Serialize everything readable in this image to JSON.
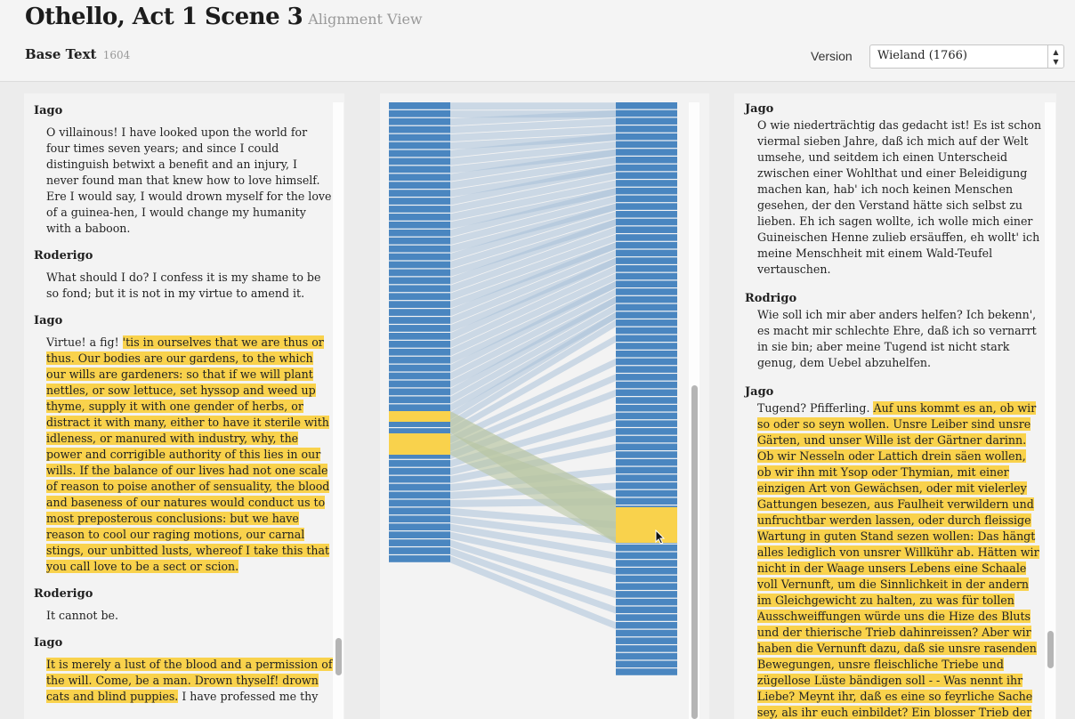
{
  "header": {
    "title": "Othello, Act 1 Scene 3",
    "subtitle": "Alignment View",
    "base_label": "Base Text",
    "base_year": "1604",
    "version_label": "Version",
    "version_selected": "Wieland (1766)"
  },
  "left": {
    "speeches": [
      {
        "speaker": "Iago",
        "plain": "O villainous! I have looked upon the world for four times seven years; and since I could distinguish betwixt a benefit and an injury, I never found man that knew how to love himself. Ere I would say, I would drown myself for the love of a guinea-hen, I would change my humanity with a baboon.",
        "highlight": "",
        "after": ""
      },
      {
        "speaker": "Roderigo",
        "plain": "What should I do? I confess it is my shame to be so fond; but it is not in my virtue to amend it.",
        "highlight": "",
        "after": ""
      },
      {
        "speaker": "Iago",
        "plain": "Virtue! a fig! ",
        "highlight": "'tis in ourselves that we are thus or thus. Our bodies are our gardens, to the which our wills are gardeners: so that if we will plant nettles, or sow lettuce, set hyssop and weed up thyme, supply it with one gender of herbs, or distract it with many, either to have it sterile with idleness, or manured with industry, why, the power and corrigible authority of this lies in our wills. If the balance of our lives had not one scale of reason to poise another of sensuality, the blood and baseness of our natures would conduct us to most preposterous conclusions: but we have reason to cool our raging motions, our carnal stings, our unbitted lusts, whereof I take this that you call love to be a sect or scion.",
        "after": ""
      },
      {
        "speaker": "Roderigo",
        "plain": "It cannot be.",
        "highlight": "",
        "after": ""
      },
      {
        "speaker": "Iago",
        "plain": "",
        "highlight": "It is merely a lust of the blood and a permission of the will. Come, be a man. Drown thyself! drown cats and blind puppies.",
        "after": " I have professed me thy"
      }
    ]
  },
  "right": {
    "speeches": [
      {
        "speaker": "Jago",
        "plain": "O wie niederträchtig das gedacht ist! Es ist schon viermal sieben Jahre, daß ich mich auf der Welt umsehe, und seitdem ich einen Unterscheid zwischen einer Wohlthat und einer Beleidigung machen kan, hab' ich noch keinen Menschen gesehen, der den Verstand hätte sich selbst zu lieben. Eh ich sagen wollte, ich wolle mich einer Guineischen Henne zulieb ersäuffen, eh wollt' ich meine Menschheit mit einem Wald-Teufel vertauschen.",
        "highlight": "",
        "after": ""
      },
      {
        "speaker": "Rodrigo",
        "plain": "Wie soll ich mir aber anders helfen? Ich bekenn', es macht mir schlechte Ehre, daß ich so vernarrt in sie bin; aber meine Tugend ist nicht stark genug, dem Uebel abzuhelfen.",
        "highlight": "",
        "after": ""
      },
      {
        "speaker": "Jago",
        "plain": "Tugend? Pfifferling. ",
        "highlight": "Auf uns kommt es an, ob wir so oder so seyn wollen. Unsre Leiber sind unsre Gärten, und unser Wille ist der Gärtner darinn. Ob wir Nesseln oder Lattich drein säen wollen, ob wir ihn mit Ysop oder Thymian, mit einer einzigen Art von Gewächsen, oder mit vielerley Gattungen besezen, aus Faulheit verwildern und unfruchtbar werden lassen, oder durch fleissige Wartung in guten Stand sezen wollen: Das hängt alles lediglich von unsrer Willkühr ab. Hätten wir nicht in der Waage unsers Lebens eine Schaale voll Vernunft, um die Sinnlichkeit in der andern im Gleichgewicht zu halten, zu was für tollen Ausschweiffungen würde uns die Hize des Bluts und der thierische Trieb dahinreissen? Aber wir haben die Vernunft dazu, daß sie unsre rasenden Bewegungen, unsre fleischliche Triebe und zügellose Lüste bändigen soll - - Was nennt ihr Liebe? Meynt ihr, daß es eine so feyrliche Sache sey, als ihr euch einbildet? Ein blosser Trieb der Blutes ist's, dem der Wille den",
        "after": ""
      }
    ]
  },
  "alignment": {
    "colors": {
      "segment": "#4a86c0",
      "highlight": "#f9d24c",
      "link": "#a9c1d8",
      "link_highlight": "#b9c6a4",
      "background": "#f3f3f3"
    }
  }
}
